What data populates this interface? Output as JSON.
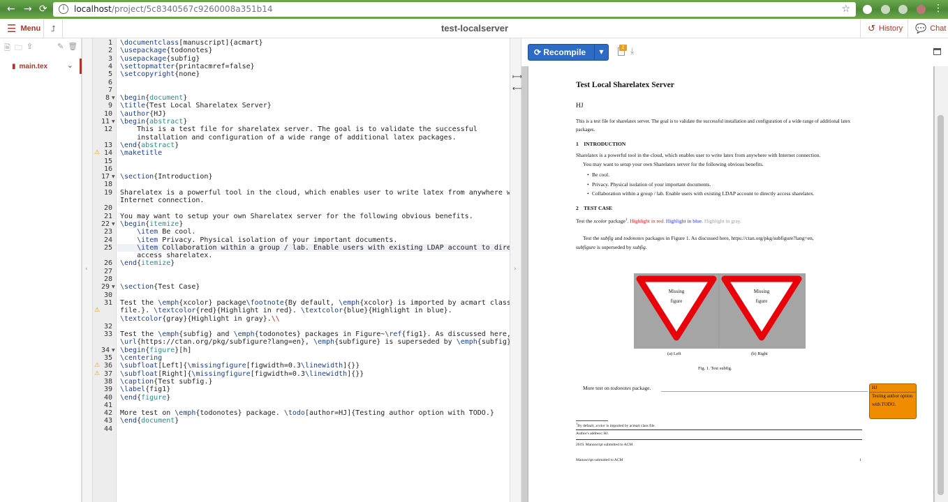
{
  "browser": {
    "url_host": "localhost",
    "url_path": "/project/5c8340567c9260008a351b14"
  },
  "toolbar": {
    "menu_label": "Menu",
    "project_title": "test-localserver",
    "history_label": "History",
    "chat_label": "Chat"
  },
  "filetree": {
    "file_name": "main.tex"
  },
  "editor": {
    "lines": [
      {
        "n": "1",
        "text": "\\documentclass[manuscript]{acmart}"
      },
      {
        "n": "2",
        "text": "\\usepackage{todonotes}"
      },
      {
        "n": "3",
        "text": "\\usepackage{subfig}"
      },
      {
        "n": "4",
        "text": "\\settopmatter{printacmref=false}"
      },
      {
        "n": "5",
        "text": "\\setcopyright{none}"
      },
      {
        "n": "6",
        "text": ""
      },
      {
        "n": "7",
        "text": ""
      },
      {
        "n": "8",
        "text": "\\begin{document}",
        "fold": true
      },
      {
        "n": "9",
        "text": "\\title{Test Local Sharelatex Server}"
      },
      {
        "n": "10",
        "text": "\\author{HJ}"
      },
      {
        "n": "11",
        "text": "\\begin{abstract}",
        "fold": true
      },
      {
        "n": "12",
        "text": "    This is a test file for sharelatex server. The goal is to validate the successful"
      },
      {
        "n": "",
        "text": "    installation and configuration of a wide range of additional latex packages."
      },
      {
        "n": "13",
        "text": "\\end{abstract}"
      },
      {
        "n": "14",
        "text": "\\maketitle",
        "warn": true
      },
      {
        "n": "15",
        "text": ""
      },
      {
        "n": "16",
        "text": ""
      },
      {
        "n": "17",
        "text": "\\section{Introduction}",
        "fold": true
      },
      {
        "n": "18",
        "text": ""
      },
      {
        "n": "19",
        "text": "Sharelatex is a powerful tool in the cloud, which enables user to write latex from anywhere with"
      },
      {
        "n": "",
        "text": "Internet connection."
      },
      {
        "n": "20",
        "text": ""
      },
      {
        "n": "21",
        "text": "You may want to setup your own Sharelatex server for the following obvious benefits."
      },
      {
        "n": "22",
        "text": "\\begin{itemize}",
        "fold": true
      },
      {
        "n": "23",
        "text": "    \\item Be cool."
      },
      {
        "n": "24",
        "text": "    \\item Privacy. Physical isolation of your important documents."
      },
      {
        "n": "25",
        "text": "    \\item Collaboration within a group / lab. Enable users with existing LDAP account to directly",
        "active": true
      },
      {
        "n": "",
        "text": "    access sharelatex."
      },
      {
        "n": "26",
        "text": "\\end{itemize}"
      },
      {
        "n": "27",
        "text": ""
      },
      {
        "n": "28",
        "text": ""
      },
      {
        "n": "29",
        "text": "\\section{Test Case}",
        "fold": true
      },
      {
        "n": "30",
        "text": ""
      },
      {
        "n": "31",
        "text": "Test the \\emph{xcolor} package\\footnote{By default, \\emph{xcolor} is imported by acmart class"
      },
      {
        "n": "",
        "text": "file.}. \\textcolor{red}{Highlight in red}. \\textcolor{blue}{Highlight in blue}.",
        "warn": true
      },
      {
        "n": "",
        "text": "\\textcolor{gray}{Highlight in gray}.\\\\"
      },
      {
        "n": "32",
        "text": ""
      },
      {
        "n": "33",
        "text": "Test the \\emph{subfig} and \\emph{todonotes} packages in Figure~\\ref{fig1}. As discussed here,"
      },
      {
        "n": "",
        "text": "\\url{https://ctan.org/pkg/subfigure?lang=en}, \\emph{subfigure} is superseded by \\emph{subfig}. \\\\"
      },
      {
        "n": "34",
        "text": "\\begin{figure}[h]",
        "fold": true
      },
      {
        "n": "35",
        "text": "\\centering"
      },
      {
        "n": "36",
        "text": "\\subfloat[Left]{\\missingfigure[figwidth=0.3\\linewidth]{}}",
        "warn": true
      },
      {
        "n": "37",
        "text": "\\subfloat[Right]{\\missingfigure[figwidth=0.3\\linewidth]{}}",
        "warn": true
      },
      {
        "n": "38",
        "text": "\\caption{Test subfig.}"
      },
      {
        "n": "39",
        "text": "\\label{fig1}"
      },
      {
        "n": "40",
        "text": "\\end{figure}"
      },
      {
        "n": "41",
        "text": ""
      },
      {
        "n": "42",
        "text": "More test on \\emph{todonotes} package. \\todo[author=HJ]{Testing author option with TODO.}"
      },
      {
        "n": "43",
        "text": "\\end{document}"
      },
      {
        "n": "44",
        "text": ""
      }
    ]
  },
  "pdf": {
    "recompile_label": "Recompile",
    "logs_badge": "2",
    "page": {
      "title": "Test Local Sharelatex Server",
      "author": "HJ",
      "abstract": "This is a test file for sharelatex server. The goal is to validate the successful installation and configuration of a wide range of additional latex packages.",
      "sec1": "1    INTRODUCTION",
      "intro_p1": "Sharelatex is a powerful tool in the cloud, which enables user to write latex from anywhere with Internet connection.",
      "intro_p2": "You may want to setup your own Sharelatex server for the following obvious benefits.",
      "bullets": [
        "Be cool.",
        "Privacy. Physical isolation of your important documents.",
        "Collaboration within a group / lab. Enable users with existing LDAP account to directly access sharelatex."
      ],
      "sec2": "2    TEST CASE",
      "xcolor_a": "Test the ",
      "xcolor_em": "xcolor",
      "xcolor_b": " package",
      "xcolor_sup": "1",
      "xcolor_c": ". ",
      "red_text": "Highlight in red.",
      "blue_text": "Highlight in blue.",
      "gray_text": "Highlight in gray.",
      "subfig_line1_a": "Test the ",
      "subfig_em1": "subfig",
      "subfig_line1_b": " and ",
      "subfig_em2": "todonotes",
      "subfig_line1_c": " packages in Figure 1. As discussed here, https://ctan.org/pkg/subfigure?lang=en,",
      "subfig_em3": "subfigure",
      "subfig_line2_b": " is superseded by ",
      "subfig_em4": "subfig",
      "subfig_line2_c": ".",
      "missing_1": "Missing",
      "missing_2": "figure",
      "sub_left": "(a) Left",
      "sub_right": "(b) Right",
      "fig_caption": "Fig. 1.  Test subfig.",
      "more_a": "More test on ",
      "more_em": "todonotes",
      "more_b": " package.",
      "todo_author": "HJ",
      "todo_text": "Testing author option with TODO.",
      "footnote_sup": "1",
      "footnote_a": "By default, ",
      "footnote_em": "xcolor",
      "footnote_b": " is imported by acmart class file.",
      "authors_address": "Author's address: HJ.",
      "submitted": "2019. Manuscript submitted to ACM",
      "running_foot": "Manuscript submitted to ACM",
      "page_num": "1"
    }
  },
  "colors": {
    "accent": "#a93529",
    "recompile": "#2d6bc4",
    "todo": "#f08c00"
  }
}
